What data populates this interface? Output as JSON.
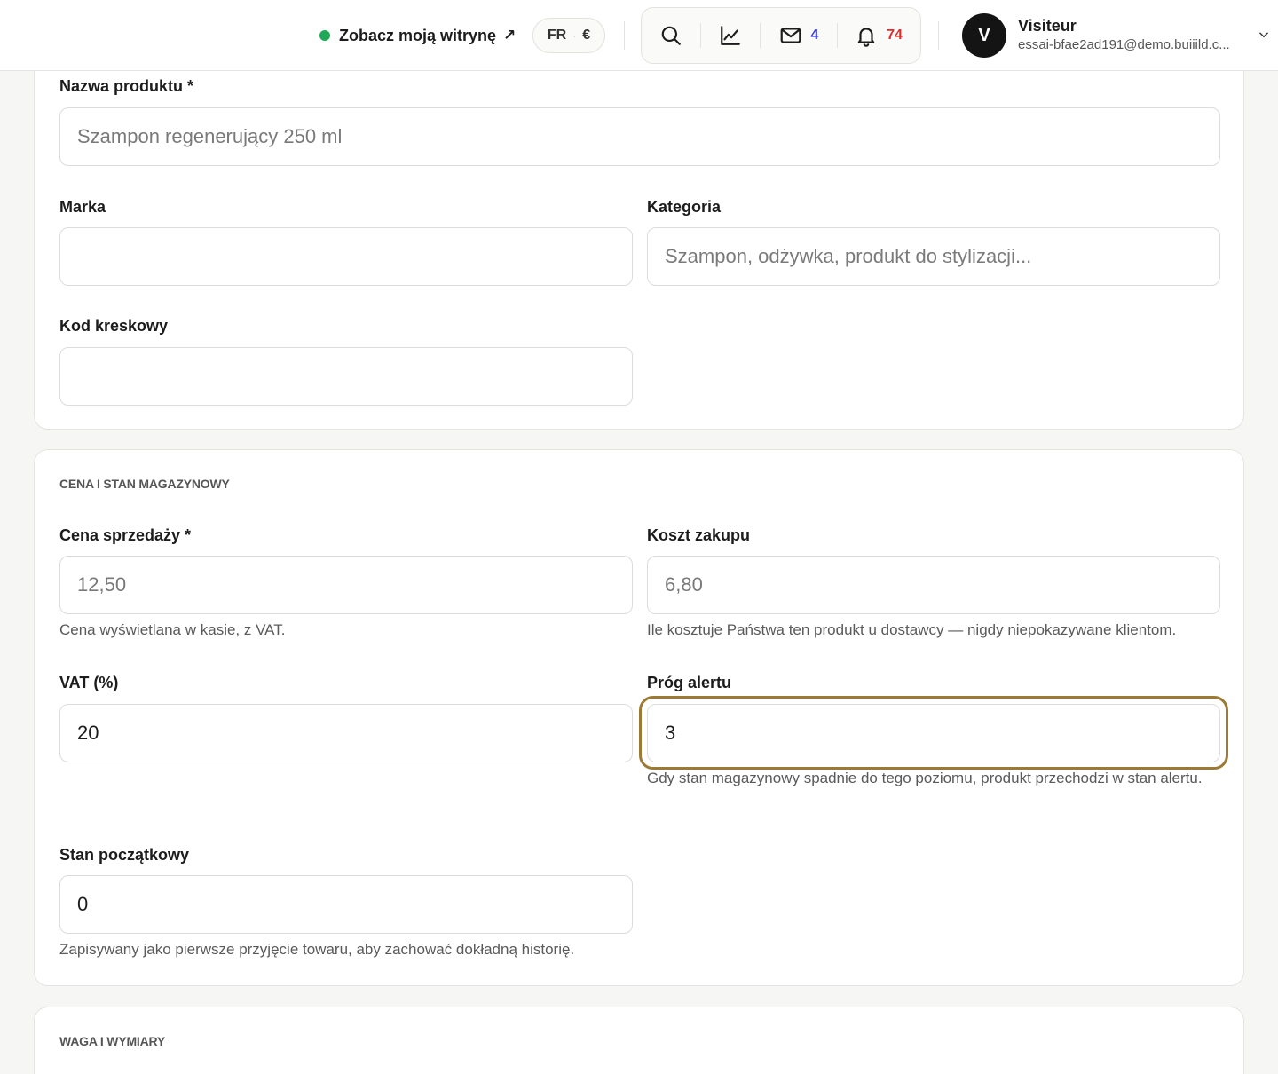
{
  "header": {
    "site_link_label": "Zobacz moją witrynę",
    "site_link_arrow": "↗",
    "lang": "FR",
    "lang_sep": "·",
    "currency": "€",
    "messages_count": "4",
    "notifications_count": "74",
    "user": {
      "initial": "V",
      "name": "Visiteur",
      "email": "essai-bfae2ad191@demo.buiiild.c..."
    },
    "icons": [
      "search-icon",
      "chart-icon",
      "mail-icon",
      "bell-icon",
      "chevron-down-icon"
    ],
    "colors": {
      "online_dot": "#1fa855",
      "messages": "#3b3fd6",
      "notifications": "#e02b2b"
    }
  },
  "product": {
    "name_label": "Nazwa produktu *",
    "name_placeholder": "Szampon regenerujący 250 ml",
    "brand_label": "Marka",
    "brand_value": "",
    "category_label": "Kategoria",
    "category_placeholder": "Szampon, odżywka, produkt do stylizacji...",
    "barcode_label": "Kod kreskowy",
    "barcode_value": ""
  },
  "pricing": {
    "section_title": "CENA I STAN MAGAZYNOWY",
    "sale_price_label": "Cena sprzedaży *",
    "sale_price_placeholder": "12,50",
    "sale_price_help": "Cena wyświetlana w kasie, z VAT.",
    "cost_label": "Koszt zakupu",
    "cost_placeholder": "6,80",
    "cost_help": "Ile kosztuje Państwa ten produkt u dostawcy — nigdy niepokazywane klientom.",
    "vat_label": "VAT (%)",
    "vat_value": "20",
    "alert_label": "Próg alertu",
    "alert_value": "3",
    "alert_help": "Gdy stan magazynowy spadnie do tego poziomu, produkt przechodzi w stan alertu.",
    "initial_stock_label": "Stan początkowy",
    "initial_stock_value": "0",
    "initial_stock_help": "Zapisywany jako pierwsze przyjęcie towaru, aby zachować dokładną historię.",
    "focus_color": "#9c7a33"
  },
  "dimensions": {
    "section_title": "WAGA I WYMIARY"
  }
}
